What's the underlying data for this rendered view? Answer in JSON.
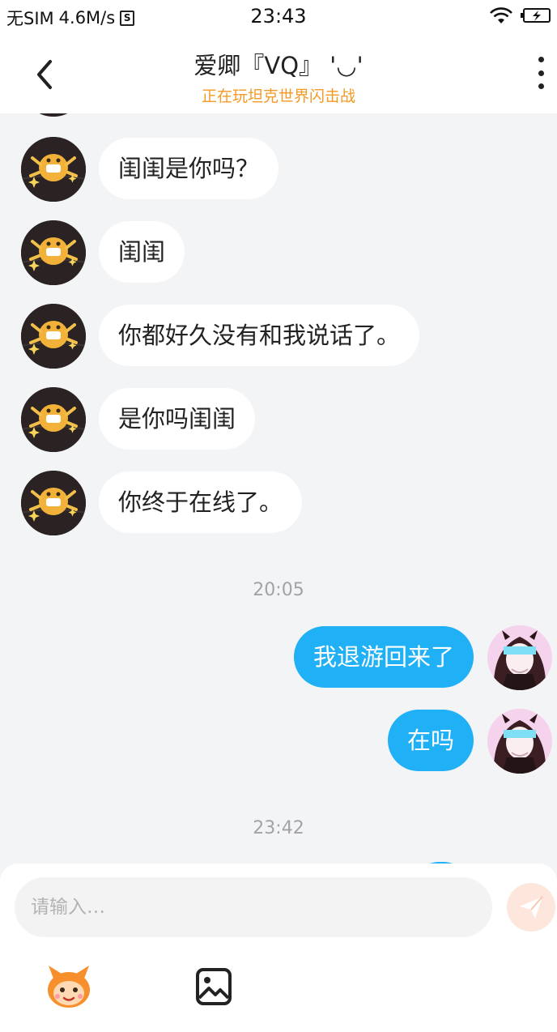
{
  "status_bar": {
    "carrier": "无SIM",
    "speed": "4.6M/s",
    "sim_icon_letter": "S",
    "time": "23:43"
  },
  "header": {
    "title": "爱卿『VQ』 '◡'",
    "subtitle": "正在玩坦克世界闪击战"
  },
  "messages_incoming": [
    "闺闺是你吗？",
    "闺闺",
    "你都好久没有和我说话了。",
    "是你吗闺闺",
    "你终于在线了。"
  ],
  "timestamps": [
    "20:05",
    "23:42"
  ],
  "messages_outgoing": [
    "我退游回来了",
    "在吗"
  ],
  "composer": {
    "placeholder": "请输入…"
  },
  "colors": {
    "accent_blue": "#1fb0f5",
    "subtitle_orange": "#f39a26",
    "send_button_bg": "#fde6dc"
  },
  "icons": {
    "back": "chevron-left-icon",
    "more": "more-vertical-icon",
    "send": "paper-plane-icon",
    "emoji": "mascot-emoji-icon",
    "image": "image-icon",
    "wifi": "wifi-icon",
    "battery": "battery-charging-icon"
  }
}
